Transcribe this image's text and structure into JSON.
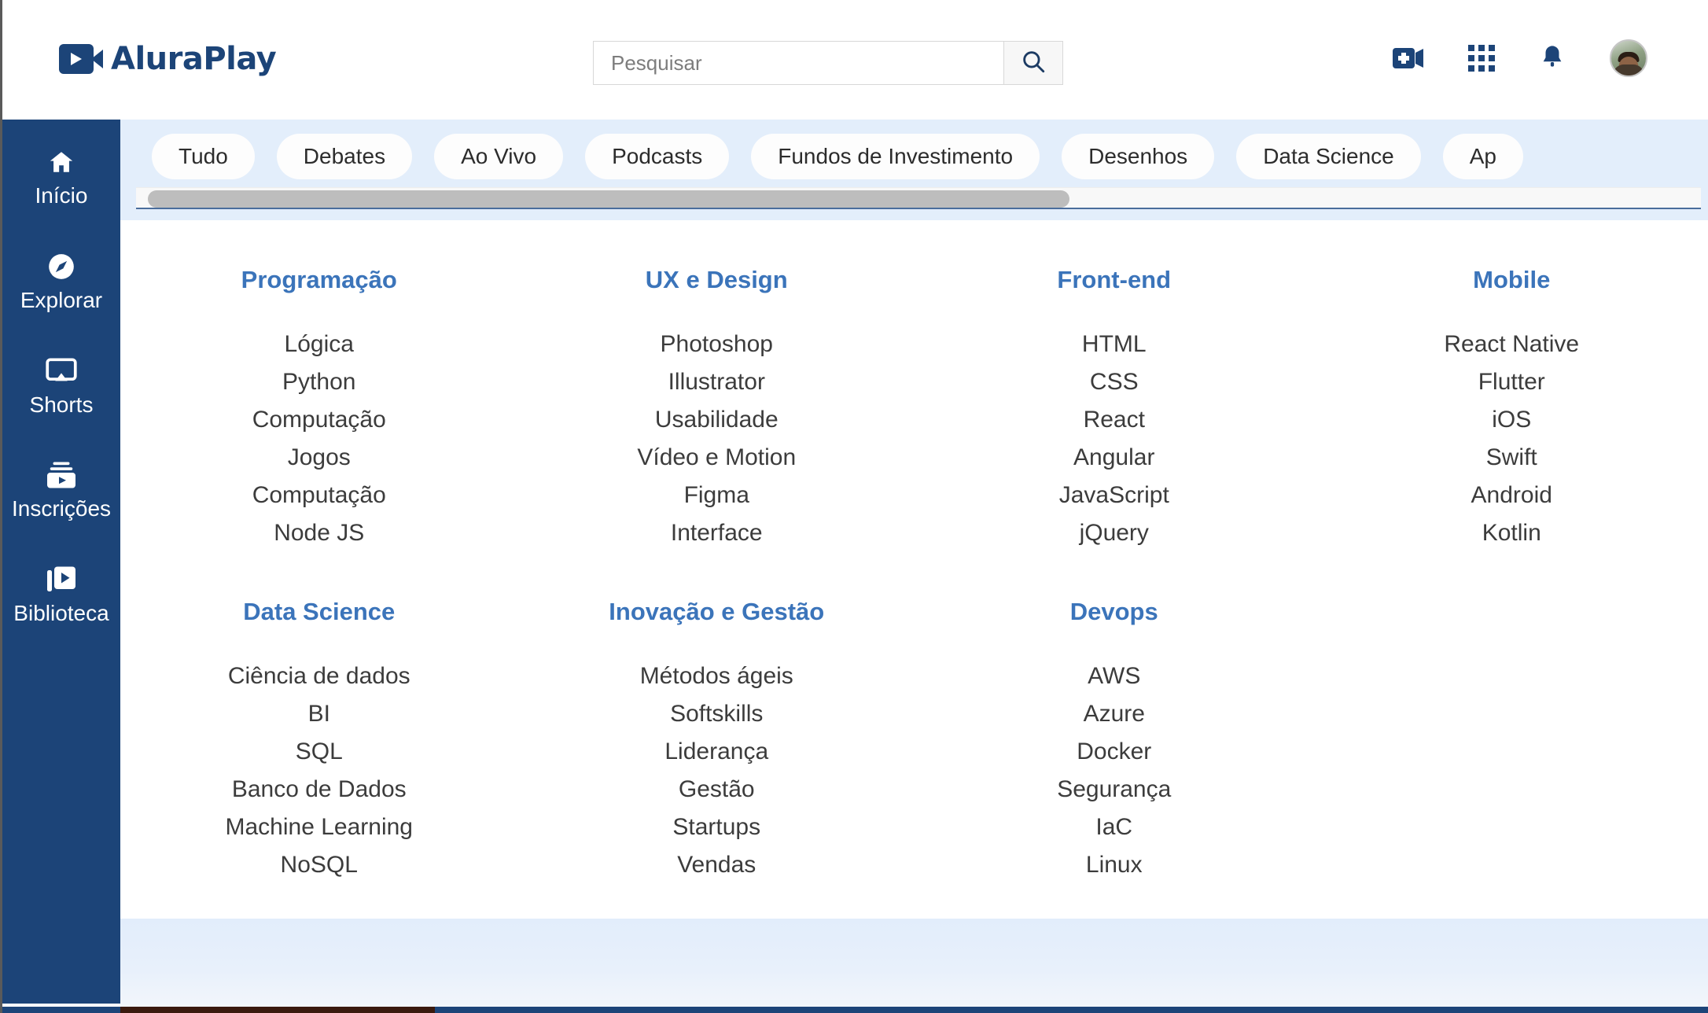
{
  "brand": {
    "name": "AluraPlay",
    "logo_icon": "video-camera-icon",
    "color": "#1c4478"
  },
  "search": {
    "placeholder": "Pesquisar",
    "value": "",
    "button_icon": "search-icon"
  },
  "header_icons": [
    {
      "name": "create-video-icon",
      "label": "Criar"
    },
    {
      "name": "apps-grid-icon",
      "label": "Apps"
    },
    {
      "name": "notifications-bell-icon",
      "label": "Notificações"
    },
    {
      "name": "user-avatar",
      "label": "Conta"
    }
  ],
  "sidebar": {
    "items": [
      {
        "label": "Início",
        "icon": "home-icon"
      },
      {
        "label": "Explorar",
        "icon": "compass-icon"
      },
      {
        "label": "Shorts",
        "icon": "shorts-screen-icon"
      },
      {
        "label": "Inscrições",
        "icon": "subscriptions-icon"
      },
      {
        "label": "Biblioteca",
        "icon": "library-icon"
      }
    ]
  },
  "chips": [
    "Tudo",
    "Debates",
    "Ao Vivo",
    "Podcasts",
    "Fundos de Investimento",
    "Desenhos",
    "Data Science",
    "Ap"
  ],
  "categories_row1": [
    {
      "title": "Programação",
      "links": [
        "Lógica",
        "Python",
        "Computação",
        "Jogos",
        "Computação",
        "Node JS"
      ]
    },
    {
      "title": "UX e Design",
      "links": [
        "Photoshop",
        "Illustrator",
        "Usabilidade",
        "Vídeo e Motion",
        "Figma",
        "Interface"
      ]
    },
    {
      "title": "Front-end",
      "links": [
        "HTML",
        "CSS",
        "React",
        "Angular",
        "JavaScript",
        "jQuery"
      ]
    },
    {
      "title": "Mobile",
      "links": [
        "React Native",
        "Flutter",
        "iOS",
        "Swift",
        "Android",
        "Kotlin"
      ]
    }
  ],
  "categories_row2": [
    {
      "title": "Data Science",
      "links": [
        "Ciência de dados",
        "BI",
        "SQL",
        "Banco de Dados",
        "Machine Learning",
        "NoSQL"
      ]
    },
    {
      "title": "Inovação e Gestão",
      "links": [
        "Métodos ágeis",
        "Softskills",
        "Liderança",
        "Gestão",
        "Startups",
        "Vendas"
      ]
    },
    {
      "title": "Devops",
      "links": [
        "AWS",
        "Azure",
        "Docker",
        "Segurança",
        "IaC",
        "Linux"
      ]
    },
    {
      "title": "",
      "links": []
    }
  ],
  "colors": {
    "brand_blue": "#1c4478",
    "category_title_blue": "#3b74ba",
    "chipbar_bg": "#e3eefb",
    "chip_bg": "#fdfdfd",
    "link_text": "#3c3c3c"
  }
}
